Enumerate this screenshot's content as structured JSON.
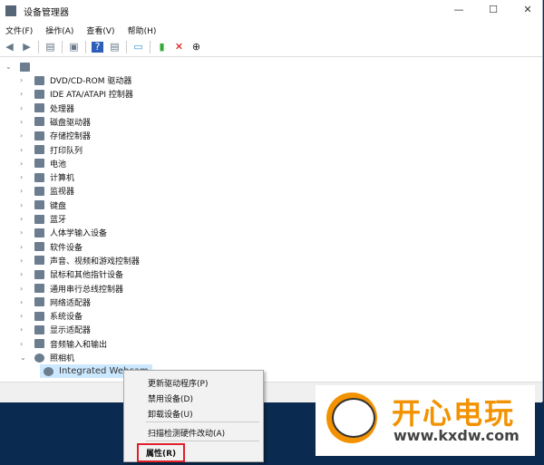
{
  "window": {
    "title": "设备管理器",
    "minimize": "—",
    "maximize": "☐",
    "close": "✕"
  },
  "menu": [
    "文件(F)",
    "操作(A)",
    "查看(V)",
    "帮助(H)"
  ],
  "tree": {
    "root": "",
    "items": [
      "DVD/CD-ROM 驱动器",
      "IDE ATA/ATAPI 控制器",
      "处理器",
      "磁盘驱动器",
      "存储控制器",
      "打印队列",
      "电池",
      "计算机",
      "监视器",
      "键盘",
      "蓝牙",
      "人体学输入设备",
      "软件设备",
      "声音、视频和游戏控制器",
      "鼠标和其他指针设备",
      "通用串行总线控制器",
      "网络适配器",
      "系统设备",
      "显示适配器",
      "音频输入和输出"
    ],
    "expanded": "照相机",
    "child": "Integrated Webcam"
  },
  "context_menu": {
    "items": [
      "更新驱动程序(P)",
      "禁用设备(D)",
      "卸载设备(U)",
      "扫描检测硬件改动(A)",
      "属性(R)"
    ]
  },
  "watermark": {
    "brand": "开心电玩",
    "url": "www.kxdw.com"
  },
  "colors": {
    "highlight": "#cce8ff",
    "red_box": "#e0202a",
    "brand": "#f39200"
  }
}
